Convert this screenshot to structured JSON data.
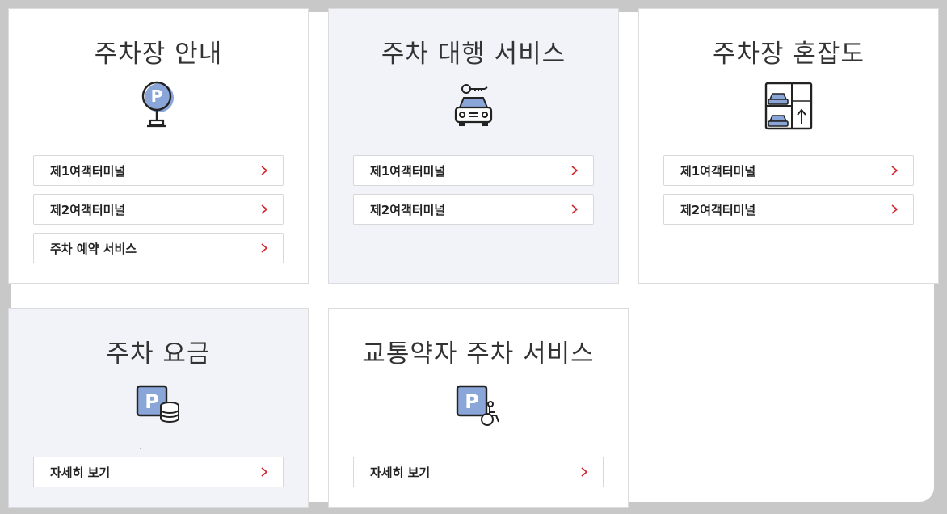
{
  "accent_color": "#d2232a",
  "icon_fill": "#8aa6d8",
  "cards": [
    {
      "title": "주차장 안내",
      "icon": "parking-sign-icon",
      "links": [
        "제1여객터미널",
        "제2여객터미널",
        "주차 예약 서비스"
      ]
    },
    {
      "title": "주차 대행 서비스",
      "icon": "valet-car-key-icon",
      "links": [
        "제1여객터미널",
        "제2여객터미널"
      ]
    },
    {
      "title": "주차장 혼잡도",
      "icon": "parking-congestion-icon",
      "links": [
        "제1여객터미널",
        "제2여객터미널"
      ]
    },
    {
      "title": "주차 요금",
      "icon": "parking-fee-icon",
      "links": [
        "자세히 보기"
      ]
    },
    {
      "title": "교통약자 주차 서비스",
      "icon": "accessible-parking-icon",
      "links": [
        "자세히 보기"
      ]
    }
  ]
}
